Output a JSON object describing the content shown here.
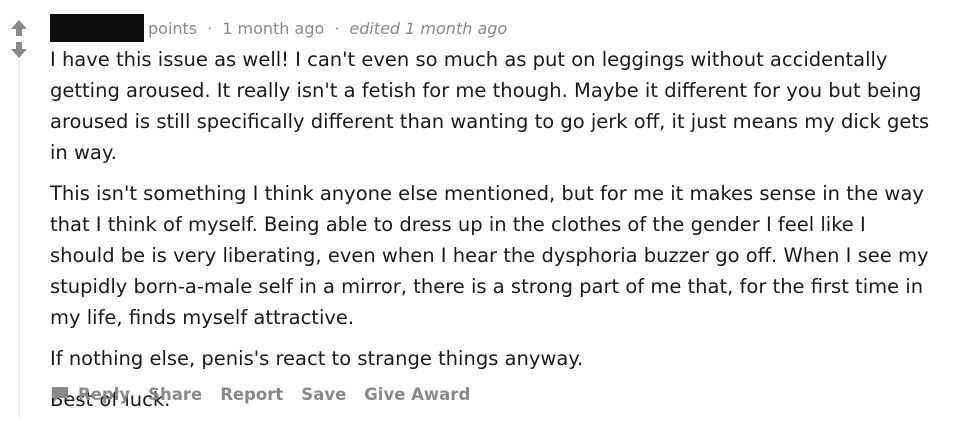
{
  "comment": {
    "meta": {
      "points_label": "points",
      "separator": "·",
      "time_ago": "1 month ago",
      "edited_label": "edited 1 month ago"
    },
    "paragraphs": [
      "I have this issue as well! I can't even so much as put on leggings without accidentally getting aroused. It really isn't a fetish for me though. Maybe it different for you but being aroused is still specifically different than wanting to go jerk off, it just means my dick gets in way.",
      "This isn't something I think anyone else mentioned, but for me it makes sense in the way that I think of myself. Being able to dress up in the clothes of the gender I feel like I should be is very liberating, even when I hear the dysphoria buzzer go off. When I see my stupidly born-a-male self in a mirror, there is a strong part of me that, for the first time in my life, finds myself attractive.",
      "If nothing else, penis's react to strange things anyway.",
      "Best of luck."
    ],
    "actions": {
      "reply": "Reply",
      "share": "Share",
      "report": "Report",
      "save": "Save",
      "give_award": "Give Award"
    },
    "icons": {
      "upvote": "upvote-arrow-icon",
      "downvote": "downvote-arrow-icon",
      "reply": "speech-bubble-icon"
    },
    "colors": {
      "arrow": "#878a8c",
      "meta_text": "#878a8c",
      "body_text": "#1a1a1b",
      "thread_line": "#edeff1",
      "redaction": "#0d0d0d"
    }
  }
}
